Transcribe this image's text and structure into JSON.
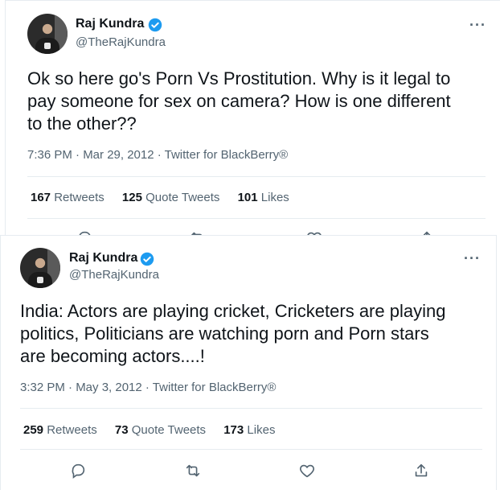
{
  "tweets": [
    {
      "name": "Raj Kundra",
      "handle": "@TheRajKundra",
      "text_lines": [
        "Ok so here go's Porn Vs Prostitution. Why is it legal to",
        "pay someone for sex on camera? How is one different",
        "to the other??"
      ],
      "meta": "7:36 PM · Mar 29, 2012 · Twitter for BlackBerry®",
      "retweets": "167",
      "retweets_label": "Retweets",
      "quotes": "125",
      "quotes_label": "Quote Tweets",
      "likes": "101",
      "likes_label": "Likes",
      "more": "···"
    },
    {
      "name": "Raj Kundra",
      "handle": "@TheRajKundra",
      "text_lines": [
        "India: Actors are playing cricket,  Cricketers are playing",
        "politics,  Politicians are watching porn  and Porn stars",
        "are becoming actors....!"
      ],
      "meta": "3:32 PM · May 3, 2012 · Twitter for BlackBerry®",
      "retweets": "259",
      "retweets_label": "Retweets",
      "quotes": "73",
      "quotes_label": "Quote Tweets",
      "likes": "173",
      "likes_label": "Likes",
      "more": "···"
    }
  ],
  "icons": {
    "reply": "reply-icon",
    "retweet": "retweet-icon",
    "like": "like-icon",
    "share": "share-icon",
    "verified": "verified-badge-icon"
  },
  "colors": {
    "verified": "#1d9bf0",
    "text": "#0f1419",
    "secondary": "#536471",
    "divider": "#e6ecf0"
  }
}
